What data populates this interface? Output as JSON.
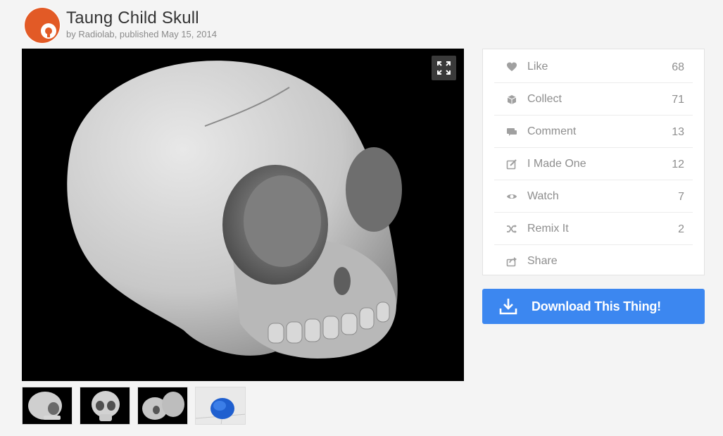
{
  "thing": {
    "title": "Taung Child Skull",
    "byline": "by Radiolab, published May 15, 2014"
  },
  "colors": {
    "avatar": "#e25a26",
    "accent": "#3c87f0",
    "icon": "#a0a0a0"
  },
  "viewer": {
    "expand_icon": "fullscreen-icon"
  },
  "thumbnails": [
    {
      "name": "skull-angled"
    },
    {
      "name": "skull-front"
    },
    {
      "name": "skull-pieces"
    },
    {
      "name": "skull-blue-print"
    }
  ],
  "actions": [
    {
      "label": "Like",
      "count": "68",
      "icon": "heart-icon"
    },
    {
      "label": "Collect",
      "count": "71",
      "icon": "collect-box-icon"
    },
    {
      "label": "Comment",
      "count": "13",
      "icon": "comment-icon"
    },
    {
      "label": "I Made One",
      "count": "12",
      "icon": "made-one-icon"
    },
    {
      "label": "Watch",
      "count": "7",
      "icon": "eye-icon"
    },
    {
      "label": "Remix It",
      "count": "2",
      "icon": "shuffle-icon"
    },
    {
      "label": "Share",
      "count": "",
      "icon": "share-icon"
    }
  ],
  "download": {
    "label": "Download This Thing!",
    "icon": "download-icon"
  }
}
